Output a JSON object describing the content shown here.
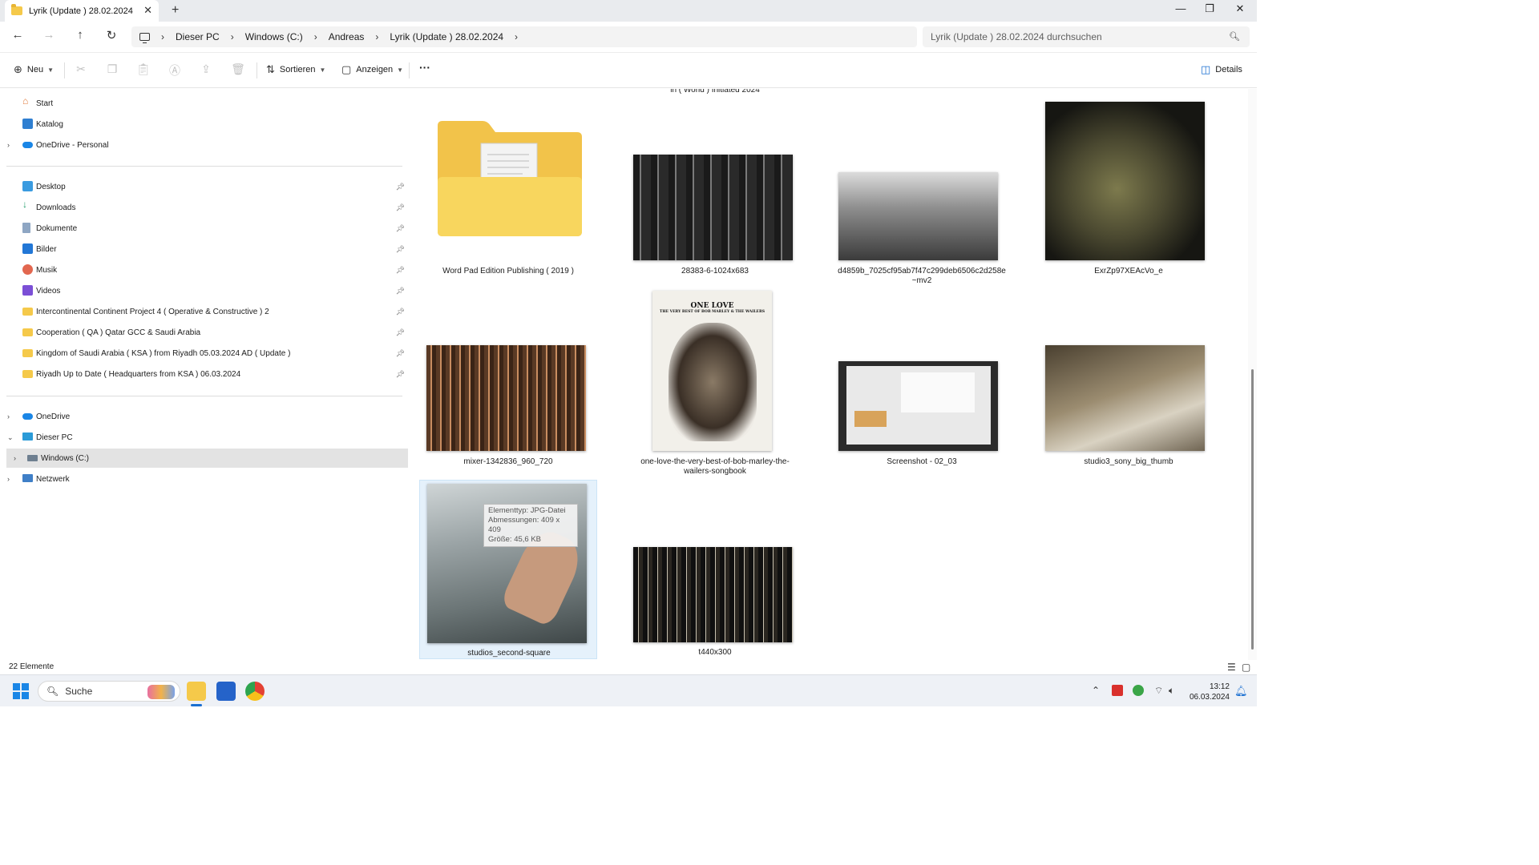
{
  "window": {
    "tab_title": "Lyrik (Update ) 28.02.2024",
    "tab_close": "✕",
    "new_tab": "+",
    "minimize": "—",
    "maximize": "❐",
    "close": "✕"
  },
  "address": {
    "crumbs": [
      "Dieser PC",
      "Windows (C:)",
      "Andreas",
      "Lyrik (Update ) 28.02.2024"
    ],
    "separator": "›",
    "search_placeholder": "Lyrik (Update ) 28.02.2024 durchsuchen"
  },
  "toolbar": {
    "new_label": "Neu",
    "sort_label": "Sortieren",
    "view_label": "Anzeigen",
    "more_label": "···",
    "details_label": "Details"
  },
  "sidebar": {
    "top": [
      {
        "label": "Start",
        "icon": "home-icon"
      },
      {
        "label": "Katalog",
        "icon": "gallery-icon"
      },
      {
        "label": "OneDrive - Personal",
        "icon": "cloud-icon"
      }
    ],
    "pinned": [
      {
        "label": "Desktop",
        "icon": "desktop-icon"
      },
      {
        "label": "Downloads",
        "icon": "download-icon"
      },
      {
        "label": "Dokumente",
        "icon": "document-icon"
      },
      {
        "label": "Bilder",
        "icon": "pictures-icon"
      },
      {
        "label": "Musik",
        "icon": "music-icon"
      },
      {
        "label": "Videos",
        "icon": "videos-icon"
      },
      {
        "label": "Intercontinental Continent Project 4 ( Operative & Constructive ) 2",
        "icon": "folder-icon"
      },
      {
        "label": "Cooperation ( QA ) Qatar GCC & Saudi Arabia",
        "icon": "folder-icon"
      },
      {
        "label": "Kingdom of Saudi Arabia ( KSA ) from Riyadh 05.03.2024 AD ( Update )",
        "icon": "folder-icon"
      },
      {
        "label": "Riyadh Up to Date ( Headquarters from KSA ) 06.03.2024",
        "icon": "folder-icon"
      }
    ],
    "bottom": [
      {
        "label": "OneDrive",
        "icon": "cloud-icon"
      },
      {
        "label": "Dieser PC",
        "icon": "pc-icon"
      },
      {
        "label": "Windows (C:)",
        "icon": "drive-icon"
      },
      {
        "label": "Netzwerk",
        "icon": "network-icon"
      }
    ]
  },
  "content": {
    "partial_caption": "in ( World ) Initiated 2024",
    "items": [
      {
        "caption": "Word Pad Edition Publishing ( 2019 )",
        "kind": "folder"
      },
      {
        "caption": "28383-6-1024x683",
        "kind": "image"
      },
      {
        "caption": "d4859b_7025cf95ab7f47c299deb6506c2d258e~mv2",
        "kind": "image"
      },
      {
        "caption": "ExrZp97XEAcVo_e",
        "kind": "image"
      },
      {
        "caption": "mixer-1342836_960_720",
        "kind": "image"
      },
      {
        "caption": "one-love-the-very-best-of-bob-marley-the-wailers-songbook",
        "kind": "image"
      },
      {
        "caption": "Screenshot - 02_03",
        "kind": "image"
      },
      {
        "caption": "studio3_sony_big_thumb",
        "kind": "image"
      },
      {
        "caption": "studios_second-square",
        "kind": "image"
      },
      {
        "caption": "t440x300",
        "kind": "image"
      }
    ],
    "book_title": "ONE LOVE",
    "book_subtitle": "THE VERY BEST OF BOB MARLEY & THE WAILERS",
    "tooltip": {
      "type": "Elementtyp: JPG-Datei",
      "dims": "Abmessungen: 409 x 409",
      "size": "Größe: 45,6 KB"
    }
  },
  "status": {
    "count": "22 Elemente"
  },
  "taskbar": {
    "search_label": "Suche",
    "time": "13:12",
    "date": "06.03.2024"
  },
  "colors": {
    "accent": "#1a6fd1",
    "folder": "#f5c94a",
    "selection": "#e5f1fb"
  }
}
